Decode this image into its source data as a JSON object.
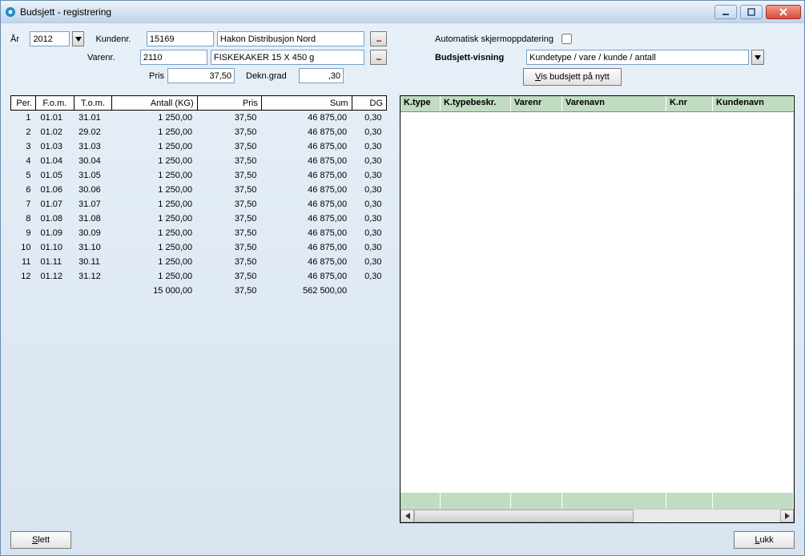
{
  "window": {
    "title": "Budsjett - registrering"
  },
  "labels": {
    "year": "År",
    "kundenr": "Kundenr.",
    "varenr": "Varenr.",
    "pris": "Pris",
    "dekngrad": "Dekn.grad",
    "autoupdate": "Automatisk skjermoppdatering",
    "budsjettvisning": "Budsjett-visning",
    "visbudsjett": "Vis budsjett på nytt",
    "slett": "Slett",
    "lukk": "Lukk"
  },
  "form": {
    "year": "2012",
    "kundenr": "15169",
    "kundenavn": "Hakon Distribusjon Nord",
    "varenr": "2110",
    "varenavn": "FISKEKAKER 15 X 450 g",
    "pris": "37,50",
    "dekngrad": ",30",
    "budvisning": "Kundetype / vare / kunde / antall"
  },
  "periods": {
    "headers": {
      "per": "Per.",
      "fom": "F.o.m.",
      "tom": "T.o.m.",
      "antall": "Antall (KG)",
      "pris": "Pris",
      "sum": "Sum",
      "dg": "DG"
    },
    "rows": [
      {
        "per": "1",
        "fom": "01.01",
        "tom": "31.01",
        "antall": "1 250,00",
        "pris": "37,50",
        "sum": "46 875,00",
        "dg": "0,30"
      },
      {
        "per": "2",
        "fom": "01.02",
        "tom": "29.02",
        "antall": "1 250,00",
        "pris": "37,50",
        "sum": "46 875,00",
        "dg": "0,30"
      },
      {
        "per": "3",
        "fom": "01.03",
        "tom": "31.03",
        "antall": "1 250,00",
        "pris": "37,50",
        "sum": "46 875,00",
        "dg": "0,30"
      },
      {
        "per": "4",
        "fom": "01.04",
        "tom": "30.04",
        "antall": "1 250,00",
        "pris": "37,50",
        "sum": "46 875,00",
        "dg": "0,30"
      },
      {
        "per": "5",
        "fom": "01.05",
        "tom": "31.05",
        "antall": "1 250,00",
        "pris": "37,50",
        "sum": "46 875,00",
        "dg": "0,30"
      },
      {
        "per": "6",
        "fom": "01.06",
        "tom": "30.06",
        "antall": "1 250,00",
        "pris": "37,50",
        "sum": "46 875,00",
        "dg": "0,30"
      },
      {
        "per": "7",
        "fom": "01.07",
        "tom": "31.07",
        "antall": "1 250,00",
        "pris": "37,50",
        "sum": "46 875,00",
        "dg": "0,30"
      },
      {
        "per": "8",
        "fom": "01.08",
        "tom": "31.08",
        "antall": "1 250,00",
        "pris": "37,50",
        "sum": "46 875,00",
        "dg": "0,30"
      },
      {
        "per": "9",
        "fom": "01.09",
        "tom": "30.09",
        "antall": "1 250,00",
        "pris": "37,50",
        "sum": "46 875,00",
        "dg": "0,30"
      },
      {
        "per": "10",
        "fom": "01.10",
        "tom": "31.10",
        "antall": "1 250,00",
        "pris": "37,50",
        "sum": "46 875,00",
        "dg": "0,30"
      },
      {
        "per": "11",
        "fom": "01.11",
        "tom": "30.11",
        "antall": "1 250,00",
        "pris": "37,50",
        "sum": "46 875,00",
        "dg": "0,30"
      },
      {
        "per": "12",
        "fom": "01.12",
        "tom": "31.12",
        "antall": "1 250,00",
        "pris": "37,50",
        "sum": "46 875,00",
        "dg": "0,30"
      }
    ],
    "totals": {
      "antall": "15 000,00",
      "pris": "37,50",
      "sum": "562 500,00"
    }
  },
  "rightgrid": {
    "headers": {
      "ktype": "K.type",
      "ktypebeskr": "K.typebeskr.",
      "varenr": "Varenr",
      "varenavn": "Varenavn",
      "knr": "K.nr",
      "kundenavn": "Kundenavn"
    }
  }
}
